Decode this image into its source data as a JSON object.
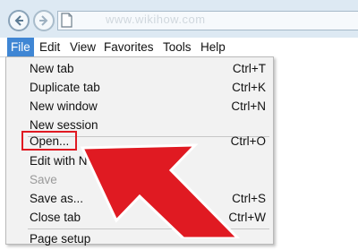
{
  "address": {
    "text": "www.wikihow.com"
  },
  "menubar": {
    "items": [
      "File",
      "Edit",
      "View",
      "Favorites",
      "Tools",
      "Help"
    ]
  },
  "file_menu": {
    "items": [
      {
        "label": "New tab",
        "shortcut": "Ctrl+T",
        "enabled": true
      },
      {
        "label": "Duplicate tab",
        "shortcut": "Ctrl+K",
        "enabled": true
      },
      {
        "label": "New window",
        "shortcut": "Ctrl+N",
        "enabled": true
      },
      {
        "label": "New session",
        "shortcut": "",
        "enabled": true
      },
      {
        "label": "Open...",
        "shortcut": "Ctrl+O",
        "enabled": true
      },
      {
        "label": "Edit with N",
        "shortcut": "",
        "enabled": true
      },
      {
        "label": "Save",
        "shortcut": "",
        "enabled": false
      },
      {
        "label": "Save as...",
        "shortcut": "Ctrl+S",
        "enabled": true
      },
      {
        "label": "Close tab",
        "shortcut": "Ctrl+W",
        "enabled": true
      },
      {
        "label": "Page setup",
        "shortcut": "",
        "enabled": true
      }
    ]
  },
  "highlight_item": "Open...",
  "colors": {
    "menubar_selected": "#3f86d4",
    "arrow": "#e01a22",
    "highlight_border": "#e01a22",
    "topbar": "#dde9f3",
    "menu_bg": "#f2f2f2"
  }
}
